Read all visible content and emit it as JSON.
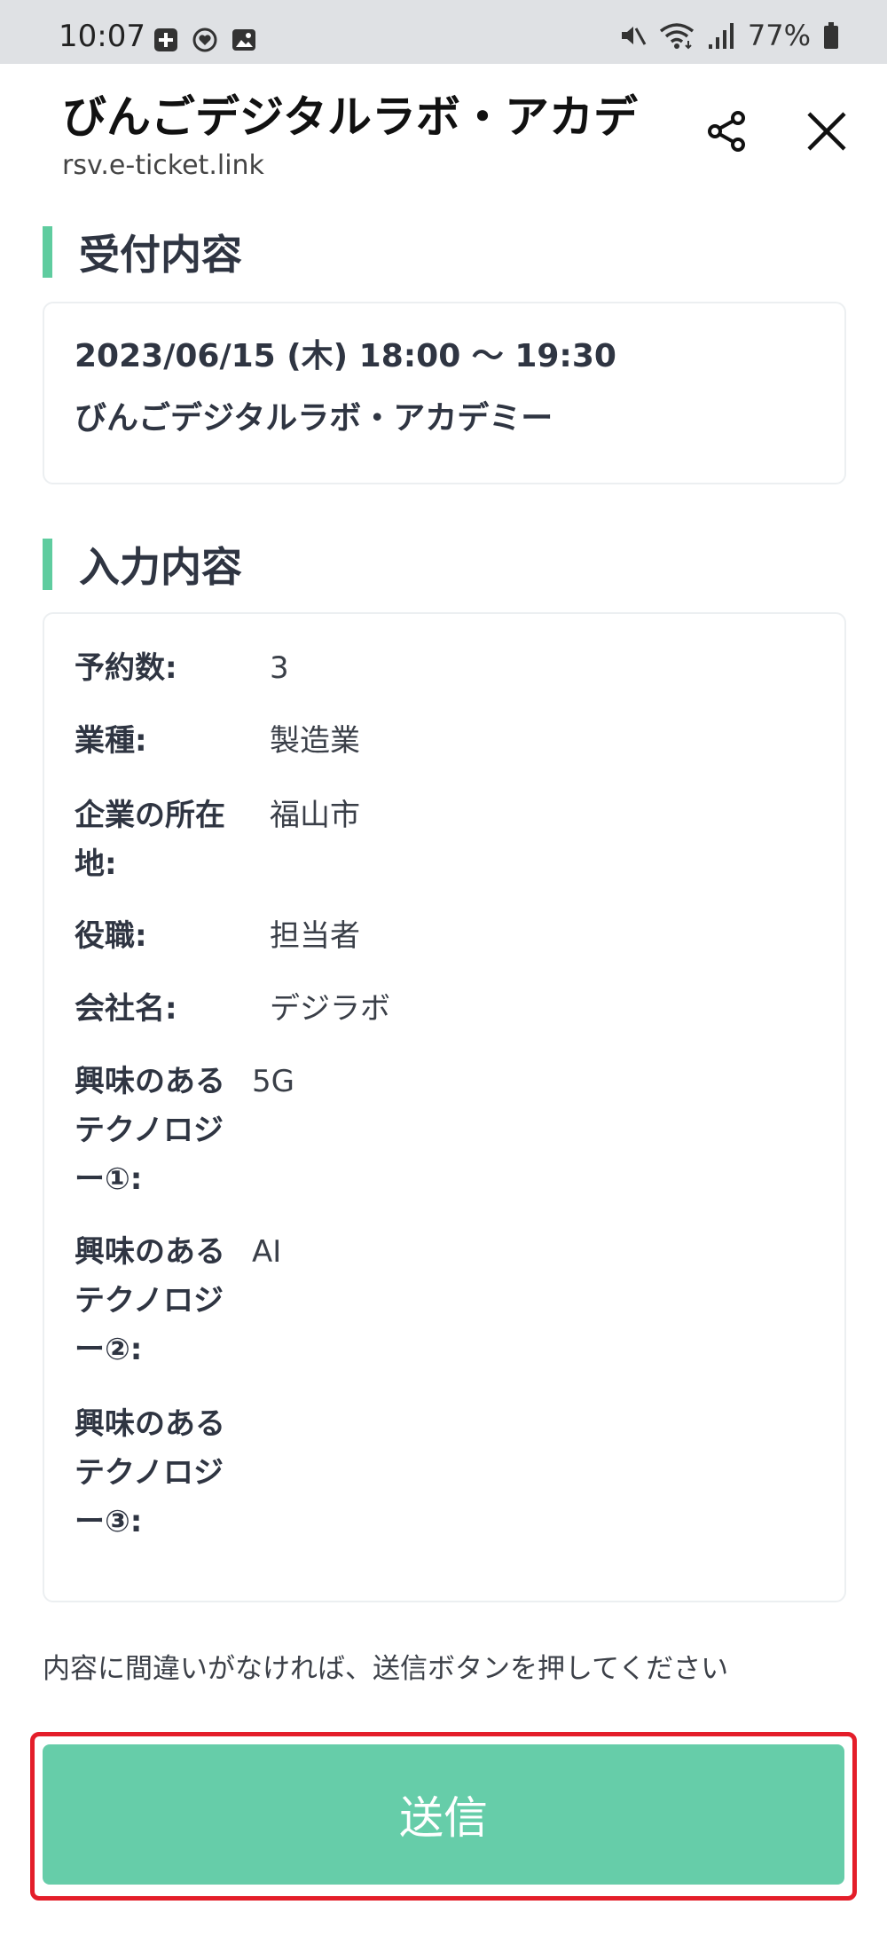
{
  "status_bar": {
    "time": "10:07",
    "battery": "77%",
    "icons_left": [
      "plus-box-icon",
      "heart-circle-icon",
      "gallery-icon"
    ],
    "icons_right": [
      "mute-icon",
      "wifi-icon",
      "signal-icon",
      "battery-icon"
    ]
  },
  "header": {
    "title": "びんごデジタルラボ・アカデ...",
    "url": "rsv.e-ticket.link",
    "share_icon": "share-icon",
    "close_icon": "close-icon"
  },
  "reception": {
    "heading": "受付内容",
    "datetime": "2023/06/15 (木) 18:00 〜 19:30",
    "event_name": "びんごデジタルラボ・アカデミー"
  },
  "input": {
    "heading": "入力内容",
    "rows": [
      {
        "label": "予約数:",
        "value": "3"
      },
      {
        "label": "業種:",
        "value": "製造業"
      },
      {
        "label": "企業の所在地:",
        "value": "福山市"
      },
      {
        "label": "役職:",
        "value": "担当者"
      },
      {
        "label": "会社名:",
        "value": "デジラボ"
      },
      {
        "label": "興味のあるテクノロジー①:",
        "value": "5G"
      },
      {
        "label": "興味のあるテクノロジー②:",
        "value": "AI"
      },
      {
        "label": "興味のあるテクノロジー③:",
        "value": ""
      }
    ]
  },
  "footer": {
    "notice": "内容に間違いがなければ、送信ボタンを押してください",
    "submit_label": "送信"
  },
  "colors": {
    "accent": "#5fcc9f",
    "button": "#66cda9",
    "highlight_border": "#e41e2a",
    "status_bar_bg": "#dfe1e4"
  }
}
